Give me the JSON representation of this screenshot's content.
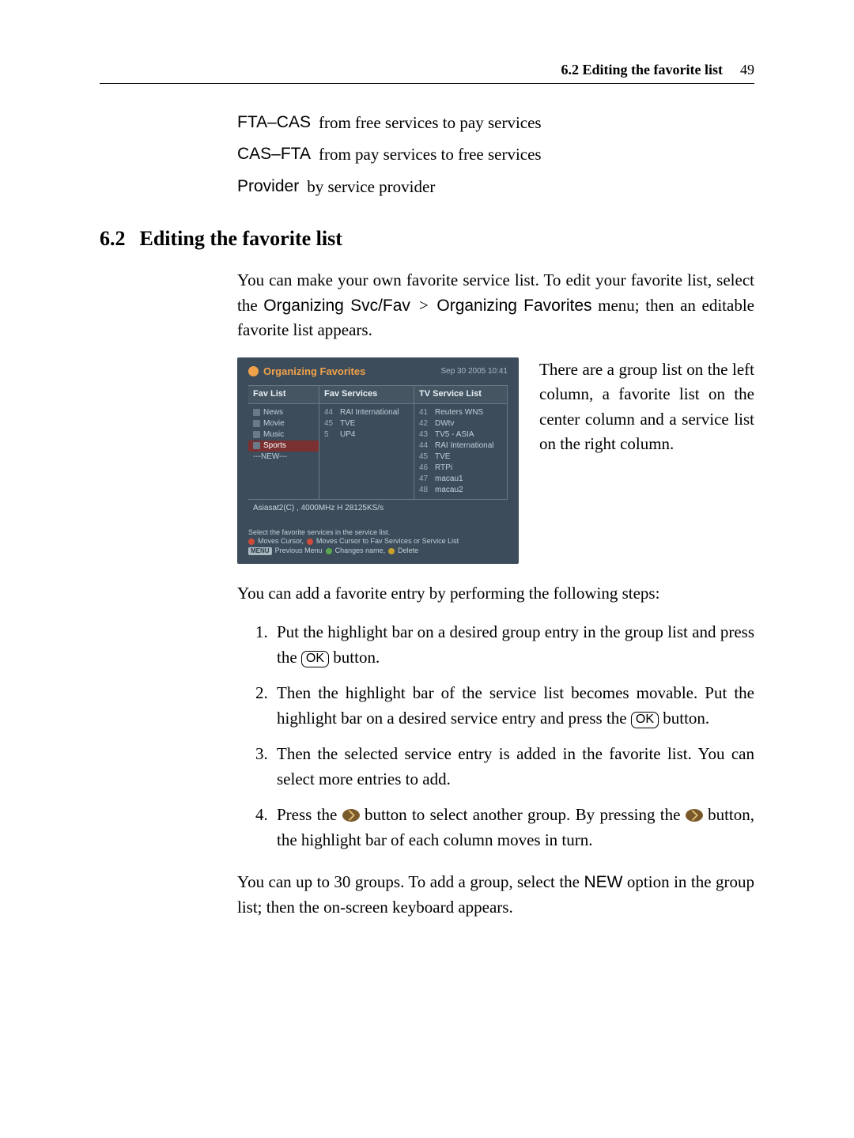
{
  "header": {
    "section_ref": "6.2 Editing the favorite list",
    "page_number": "49"
  },
  "defs": [
    {
      "term": "FTA–CAS",
      "desc": "from free services to pay services"
    },
    {
      "term": "CAS–FTA",
      "desc": "from pay services to free services"
    },
    {
      "term": "Provider",
      "desc": "by service provider"
    }
  ],
  "heading": {
    "number": "6.2",
    "title": "Editing the favorite list"
  },
  "intro": {
    "pre": "You can make your own favorite service list.   To edit your favorite list, select the ",
    "menu1": "Organizing Svc/Fav",
    "gt": ">",
    "menu2": "Organizing Favorites",
    "post": " menu; then an editable favorite list appears."
  },
  "figure_side": "There are a group list on the left column, a favorite list on the center column and a service list on the right column.",
  "after_figure": "You can add a favorite entry by performing the following steps:",
  "steps": [
    {
      "p1": "Put the highlight bar on a desired group entry in the group list and press the ",
      "ok": "OK",
      "p2": " button."
    },
    {
      "p1": "Then the highlight bar of the service list becomes movable. Put the highlight bar on a desired service entry and press the ",
      "ok": "OK",
      "p2": " button."
    },
    {
      "p1": "Then the selected service entry is added in the favorite list. You can select more entries to add."
    },
    {
      "p1": "Press the ",
      "mid": " button to select another group. By pressing the ",
      "p2": " button, the highlight bar of each column moves in turn."
    }
  ],
  "final": {
    "pre": "You can up to 30 groups.  To add a group, select the ",
    "new_label": "NEW",
    "post": " option in the group list; then the on-screen keyboard appears."
  },
  "screenshot": {
    "title": "Organizing Favorites",
    "datetime": "Sep 30 2005 10:41",
    "col_headers": [
      "Fav List",
      "Fav Services",
      "TV Service List"
    ],
    "fav_list": [
      {
        "label": "News",
        "selected": false
      },
      {
        "label": "Movie",
        "selected": false
      },
      {
        "label": "Music",
        "selected": false
      },
      {
        "label": "Sports",
        "selected": true
      },
      {
        "label": "---NEW---",
        "selected": false
      }
    ],
    "fav_services": [
      {
        "num": "44",
        "name": "RAI International"
      },
      {
        "num": "45",
        "name": "TVE"
      },
      {
        "num": "5",
        "name": "UP4"
      }
    ],
    "tv_service_list": [
      {
        "num": "41",
        "name": "Reuters WNS"
      },
      {
        "num": "42",
        "name": "DWtv"
      },
      {
        "num": "43",
        "name": "TV5 - ASIA"
      },
      {
        "num": "44",
        "name": "RAI International"
      },
      {
        "num": "45",
        "name": "TVE"
      },
      {
        "num": "46",
        "name": "RTPi"
      },
      {
        "num": "47",
        "name": "macau1"
      },
      {
        "num": "48",
        "name": "macau2"
      }
    ],
    "status_line": "Asiasat2(C) , 4000MHz H 28125KS/s",
    "footer": {
      "line1": "Select the favorite services in the service list.",
      "moves_cursor": "Moves Cursor,",
      "moves_cursor_to": "Moves Cursor to Fav Services or Service List",
      "menu_key": "MENU",
      "previous_menu": "Previous Menu",
      "changes_name": "Changes name,",
      "delete": "Delete"
    }
  }
}
